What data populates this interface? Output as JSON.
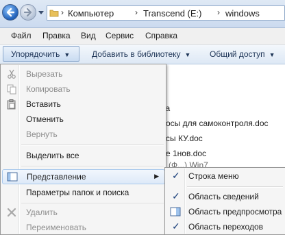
{
  "addressbar": {
    "crumbs": [
      "Компьютер",
      "Transcend (E:)",
      "windows"
    ]
  },
  "menubar": {
    "items": [
      "Файл",
      "Правка",
      "Вид",
      "Сервис",
      "Справка"
    ]
  },
  "commandbar": {
    "organize": "Упорядочить",
    "add_to_library": "Добавить в библиотеку",
    "share": "Общий доступ"
  },
  "files": {
    "items": [
      "ка",
      "осы для самоконтроля.doc",
      "сы КУ.doc",
      "е 1нов.doc",
      "(Ф...) Win7"
    ]
  },
  "dropdown": {
    "items": [
      {
        "label": "Вырезать",
        "disabled": true,
        "icon": "scissors-icon"
      },
      {
        "label": "Копировать",
        "disabled": true,
        "icon": "copy-icon"
      },
      {
        "label": "Вставить",
        "disabled": false,
        "icon": "paste-icon"
      },
      {
        "label": "Отменить",
        "disabled": false,
        "icon": ""
      },
      {
        "label": "Вернуть",
        "disabled": true,
        "icon": ""
      },
      {
        "label": "Выделить все",
        "disabled": false,
        "icon": ""
      },
      {
        "label": "Представление",
        "disabled": false,
        "icon": "layout-icon",
        "submenu": true
      },
      {
        "label": "Параметры папок и поиска",
        "disabled": false,
        "icon": ""
      },
      {
        "label": "Удалить",
        "disabled": true,
        "icon": "delete-icon"
      },
      {
        "label": "Переименовать",
        "disabled": true,
        "icon": ""
      }
    ]
  },
  "submenu": {
    "items": [
      {
        "label": "Строка меню",
        "checked": true
      },
      {
        "label": "Область сведений",
        "checked": true
      },
      {
        "label": "Область предпросмотра",
        "checked": false,
        "icon": "preview-pane-icon"
      },
      {
        "label": "Область переходов",
        "checked": true
      }
    ]
  },
  "colors": {
    "accent": "#1f5fb8",
    "highlight_border": "#a8c8ec",
    "disabled_text": "#8d8d8d"
  }
}
